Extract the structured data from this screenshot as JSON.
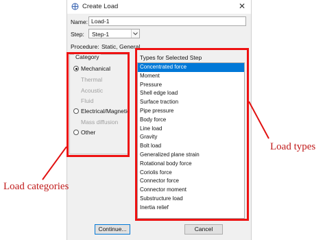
{
  "window": {
    "title": "Create Load",
    "close_glyph": "✕"
  },
  "form": {
    "name_label": "Name:",
    "name_value": "Load-1",
    "step_label": "Step:",
    "step_value": "Step-1",
    "procedure_label": "Procedure:",
    "procedure_value": "Static, General"
  },
  "category": {
    "title": "Category",
    "selected": "Mechanical",
    "options": [
      {
        "label": "Mechanical",
        "enabled": true
      },
      {
        "label": "Thermal",
        "enabled": false
      },
      {
        "label": "Acoustic",
        "enabled": false
      },
      {
        "label": "Fluid",
        "enabled": false
      },
      {
        "label": "Electrical/Magnetic",
        "enabled": true
      },
      {
        "label": "Mass diffusion",
        "enabled": false
      },
      {
        "label": "Other",
        "enabled": true
      }
    ]
  },
  "types": {
    "title": "Types for Selected Step",
    "selected": "Concentrated force",
    "items": [
      "Concentrated force",
      "Moment",
      "Pressure",
      "Shell edge load",
      "Surface traction",
      "Pipe pressure",
      "Body force",
      "Line load",
      "Gravity",
      "Bolt load",
      "Generalized plane strain",
      "Rotational body force",
      "Coriolis force",
      "Connector force",
      "Connector moment",
      "Substructure load",
      "Inertia relief"
    ]
  },
  "buttons": {
    "continue": "Continue...",
    "cancel": "Cancel"
  },
  "annotations": {
    "left": "Load categories",
    "right": "Load types",
    "color": "#e11111"
  }
}
